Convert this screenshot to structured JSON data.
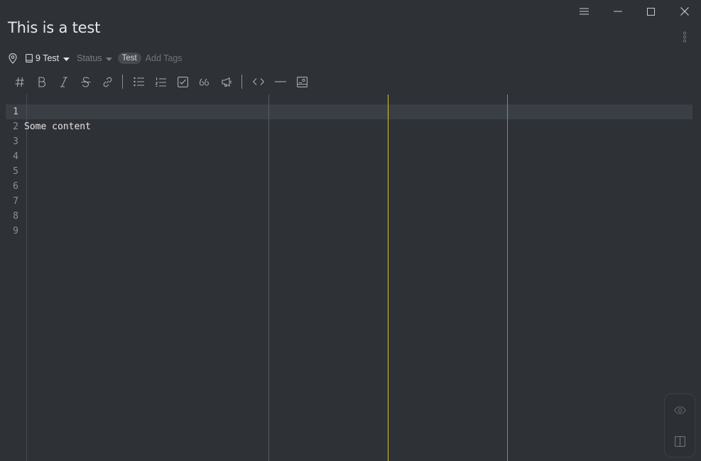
{
  "window": {
    "controls": [
      "menu-icon",
      "minimize-icon",
      "maximize-icon",
      "close-icon"
    ]
  },
  "note": {
    "title": "This is a test"
  },
  "meta": {
    "notebook": "9 Test",
    "status": "Status",
    "tags": [
      "Test"
    ],
    "add_tags": "Add Tags"
  },
  "toolbar": {
    "groups": [
      [
        "heading-icon",
        "bold-icon",
        "italic-icon",
        "strikethrough-icon",
        "link-icon"
      ],
      [
        "bullet-list-icon",
        "numbered-list-icon",
        "checkbox-list-icon",
        "quote-icon",
        "callout-icon"
      ],
      [
        "code-icon",
        "horizontal-rule-icon",
        "image-icon"
      ]
    ]
  },
  "editor": {
    "lines": [
      {
        "number": "1",
        "text": ""
      },
      {
        "number": "2",
        "text": "Some content"
      },
      {
        "number": "3",
        "text": ""
      },
      {
        "number": "4",
        "text": ""
      },
      {
        "number": "5",
        "text": ""
      },
      {
        "number": "6",
        "text": ""
      },
      {
        "number": "7",
        "text": ""
      },
      {
        "number": "8",
        "text": ""
      },
      {
        "number": "9",
        "text": ""
      }
    ],
    "ruler_colors": [
      "#5a5e64",
      "#d4c42a",
      "#d0656b"
    ]
  },
  "side_panel": [
    "preview-eye-icon",
    "split-view-icon"
  ],
  "colors": {
    "background": "#2e3136",
    "active_line": "#3a3f46",
    "tag_chip": "#474b51"
  }
}
